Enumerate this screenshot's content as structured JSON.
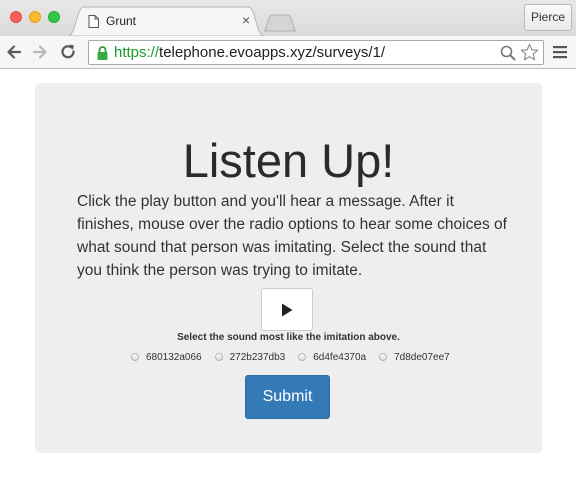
{
  "browser": {
    "tab": {
      "title": "Grunt",
      "close_symbol": "×"
    },
    "profile_name": "Pierce",
    "address": {
      "scheme": "https://",
      "rest": "telephone.evoapps.xyz/surveys/1/"
    }
  },
  "page": {
    "heading": "Listen Up!",
    "instructions": "Click the play button and you'll hear a message. After it finishes, mouse over the radio options to hear some choices of what sound that person was imitating. Select the sound that you think the person was trying to imitate.",
    "prompt": "Select the sound most like the imitation above.",
    "options": [
      "680132a066",
      "272b237db3",
      "6d4fe4370a",
      "7d8de07ee7"
    ],
    "submit_label": "Submit"
  },
  "colors": {
    "submit_bg": "#337ab7",
    "secure_green": "#1b9d2c",
    "panel_bg": "#eeeeee"
  },
  "icons": [
    "document-icon",
    "close-icon",
    "back-arrow-icon",
    "forward-arrow-icon",
    "reload-icon",
    "lock-icon",
    "zoom-icon",
    "star-icon",
    "menu-icon",
    "play-icon"
  ]
}
